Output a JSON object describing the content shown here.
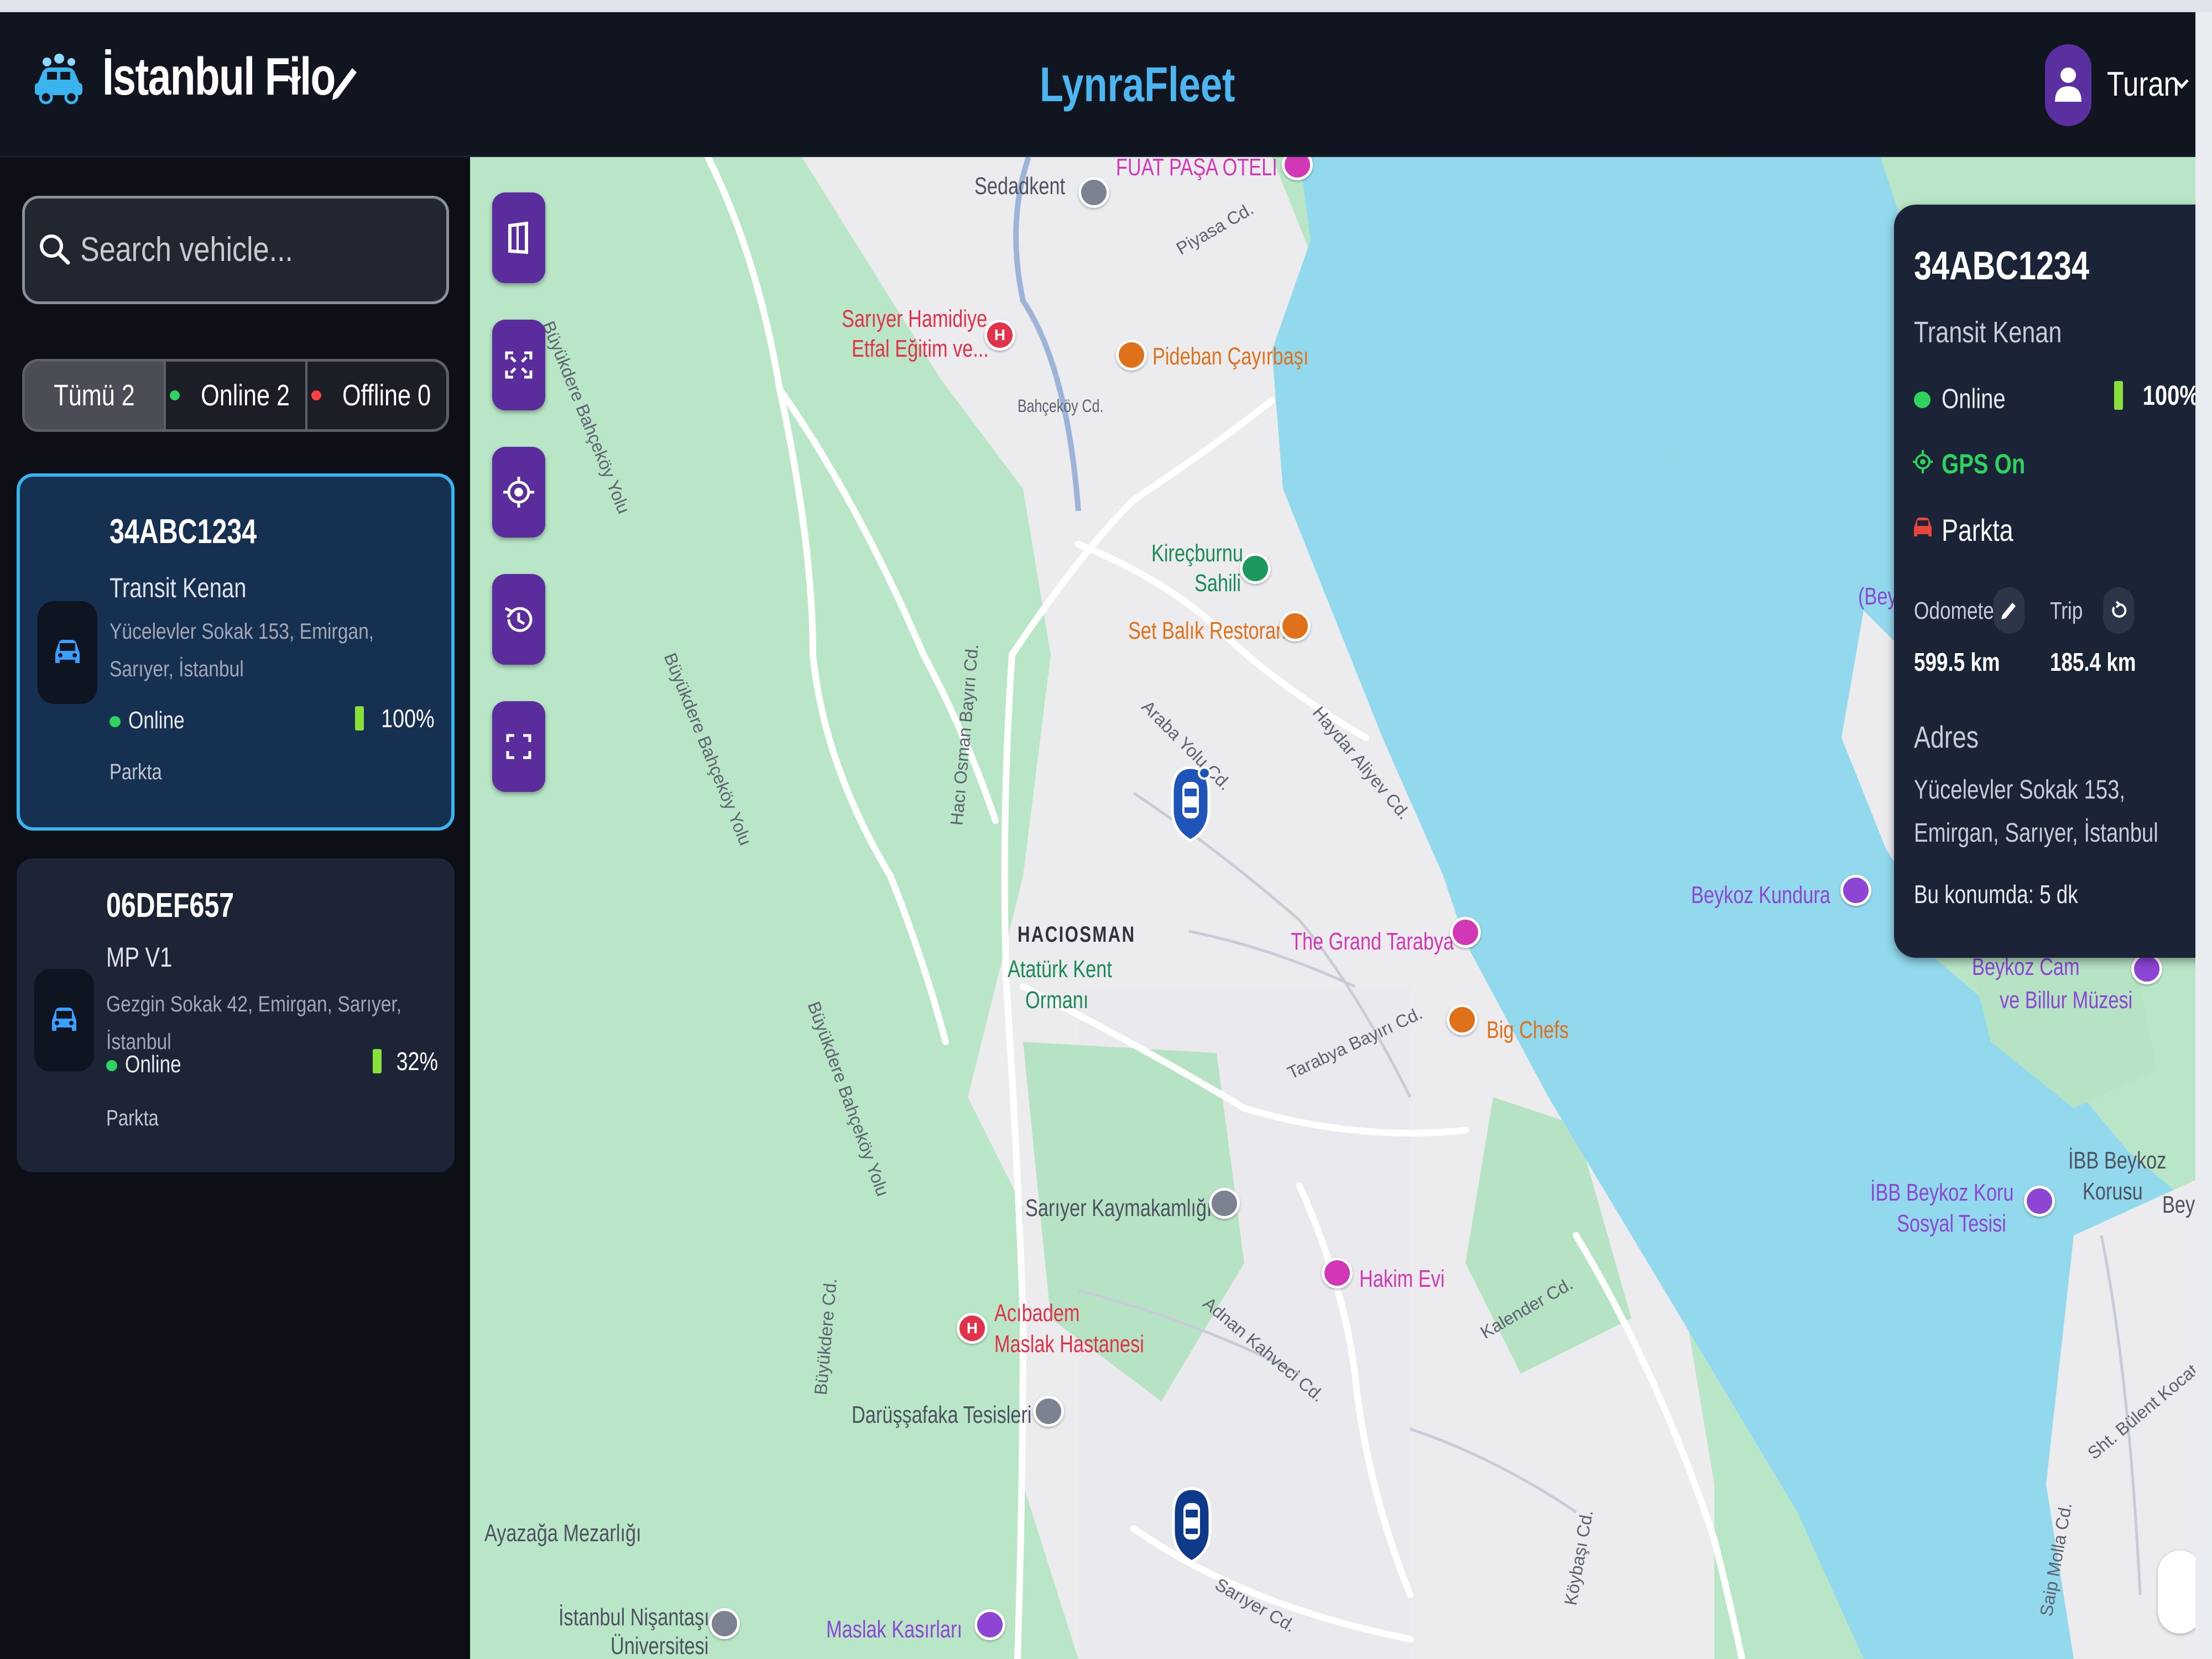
{
  "header": {
    "fleet_name": "İstanbul Filo",
    "brand": "LynraFleet",
    "user_name": "Turan"
  },
  "sidebar": {
    "search": {
      "placeholder": "Search vehicle..."
    },
    "filters": [
      {
        "label": "Tümü 2",
        "active": true
      },
      {
        "label": "Online 2",
        "dot_color": "#2fd25f"
      },
      {
        "label": "Offline 0",
        "dot_color": "#ff4040"
      }
    ],
    "vehicles": [
      {
        "plate": "34ABC1234",
        "model": "Transit Kenan",
        "address": "Yücelevler Sokak 153, Emirgan, Sarıyer, İstanbul",
        "status": "Online",
        "battery": "100%",
        "battery_level": 1.0,
        "state": "Parkta",
        "selected": true
      },
      {
        "plate": "06DEF657",
        "model": "MP V1",
        "address": "Gezgin Sokak 42, Emirgan, Sarıyer, İstanbul",
        "status": "Online",
        "battery": "32%",
        "battery_level": 0.32,
        "state": "Parkta",
        "selected": false
      }
    ]
  },
  "map": {
    "controls": [
      "map-layers",
      "fit-bounds",
      "locate",
      "history",
      "fullscreen"
    ],
    "labels": {
      "sedadkent": "Sedadkent",
      "fuat": "FUAT PAŞA OTELİ",
      "hamidiye": "Sarıyer Hamidiye",
      "hamidiye2": "Etfal Eğitim ve...",
      "pideban": "Pideban Çayırbaşı",
      "bahcekoy": "Bahçeköy Cd.",
      "piyasa": "Piyasa Cd.",
      "kirecburnu": "Kireçburnu",
      "sahili": "Sahili",
      "setbalik": "Set Balık Restoran",
      "araba": "Araba Yolu Cd.",
      "haydar": "Haydar Aliyev Cd.",
      "hacios_cd": "Hacı Osman Bayırı Cd.",
      "buyukdere1": "Büyükdere Bahçeköy Yolu",
      "buyukdere2": "Büyükdere Bahçeköy Yolu",
      "buyukdere3": "Büyükdere Bahçeköy Yolu",
      "haciosman": "HACIOSMAN",
      "ataturk": "Atatürk Kent",
      "ormani": "Ormanı",
      "grand": "The Grand Tarabya",
      "bigchefs": "Big Chefs",
      "tarabya": "Tarabya Bayırı Cd.",
      "beykoz_kundura": "Beykoz Kundura",
      "beykoz_cam": "Beykoz Cam",
      "billur": "ve Billur Müzesi",
      "beykoz_paren": "(Bey",
      "kaymakam": "Sarıyer Kaymakamlığı",
      "hakim": "Hakim Evi",
      "adnan": "Adnan Kahveci Cd.",
      "kalender": "Kalender Cd.",
      "acibadem": "Acıbadem",
      "maslak_h": "Maslak Hastanesi",
      "darussafaka": "Darüşşafaka Tesisleri",
      "ayazaga": "Ayazağa Mezarlığı",
      "nisantasi": "İstanbul Nişantaşı",
      "universitesi": "Üniversitesi",
      "kasirlari": "Maslak Kasırları",
      "sariyer_cd": "Sarıyer Cd.",
      "koybasi": "Köybaşı Cd.",
      "ibb_koru": "İBB Beykoz Koru",
      "sosyal": "Sosyal Tesisi",
      "ibb_korusu1": "İBB Beykoz",
      "ibb_korusu2": "Korusu",
      "bey_right": "Bey",
      "bulent": "Sht. Bülent Kocat",
      "saip": "Saip Molla Cd.",
      "buyukdere_cd": "Büyükdere Cd."
    }
  },
  "info_panel": {
    "plate": "34ABC1234",
    "model": "Transit Kenan",
    "status": "Online",
    "battery": "100%",
    "battery_level": 1.0,
    "gps": "GPS On",
    "state": "Parkta",
    "odometer_label": "Odometer",
    "trip_label": "Trip",
    "odometer_value": "599.5 km",
    "trip_value": "185.4 km",
    "address_label": "Adres",
    "address": "Yücelevler Sokak 153, Emirgan, Sarıyer, İstanbul",
    "duration": "Bu konumda: 5 dk"
  },
  "colors": {
    "accent": "#39b4ef",
    "brand": "#4db6f0",
    "control_purple": "#5b2d9c",
    "online_green": "#2fd25f",
    "offline_red": "#ff4040",
    "water": "#92d9ee",
    "land": "#b9e6c7"
  }
}
